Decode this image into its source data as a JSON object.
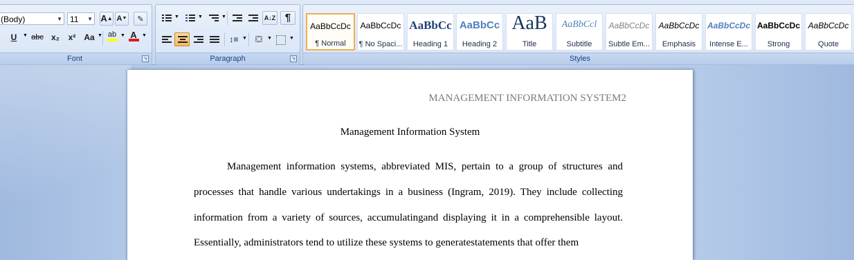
{
  "font_group": {
    "font_name": "(Body)",
    "font_size": "11",
    "grow_label": "A",
    "shrink_label": "A",
    "underline_label": "U",
    "strike_label": "abc",
    "subscript_label": "x₂",
    "superscript_label": "x²",
    "case_label": "Aa",
    "highlight_label": "ab",
    "font_color_label": "A",
    "group_label": "Font",
    "highlight_color": "#ffff00",
    "font_color": "#e11b1b"
  },
  "paragraph_group": {
    "sort_label": "A↓Z",
    "show_marks_label": "¶",
    "group_label": "Paragraph"
  },
  "styles_group": {
    "group_label": "Styles",
    "items": [
      {
        "sample": "AaBbCcDc",
        "name": "¶ Normal"
      },
      {
        "sample": "AaBbCcDc",
        "name": "¶ No Spaci..."
      },
      {
        "sample": "AaBbCc",
        "name": "Heading 1"
      },
      {
        "sample": "AaBbCc",
        "name": "Heading 2"
      },
      {
        "sample": "AaB",
        "name": "Title"
      },
      {
        "sample": "AaBbCcl",
        "name": "Subtitle"
      },
      {
        "sample": "AaBbCcDc",
        "name": "Subtle Em..."
      },
      {
        "sample": "AaBbCcDc",
        "name": "Emphasis"
      },
      {
        "sample": "AaBbCcDc",
        "name": "Intense E..."
      },
      {
        "sample": "AaBbCcDc",
        "name": "Strong"
      },
      {
        "sample": "AaBbCcDc",
        "name": "Quote"
      }
    ]
  },
  "document": {
    "header": "MANAGEMENT INFORMATION SYSTEM2",
    "title": "Management Information System",
    "lines": [
      "Management information systems, abbreviated MIS, pertain to a group of structures and",
      "processes that handle various undertakings in a business (Ingram, 2019). They include collecting",
      "information from a variety of sources, accumulatingand displaying it in a comprehensible layout.",
      "Essentially, administrators tend to utilize these systems to generatestatements that offer them"
    ]
  }
}
